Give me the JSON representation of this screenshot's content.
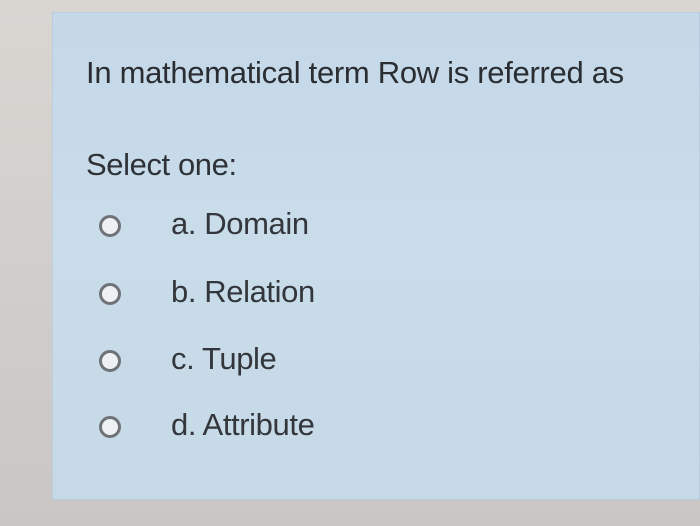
{
  "question": {
    "text": "In mathematical term Row is referred as"
  },
  "answer": {
    "prompt": "Select one:",
    "options": [
      {
        "label": "a. Domain"
      },
      {
        "label": "b. Relation"
      },
      {
        "label": "c. Tuple"
      },
      {
        "label": "d. Attribute"
      }
    ]
  },
  "colors": {
    "card_background": "#c6d9e7",
    "page_background": "#d3d0cc",
    "text": "#2a2e33",
    "radio_border": "#6f7378"
  }
}
